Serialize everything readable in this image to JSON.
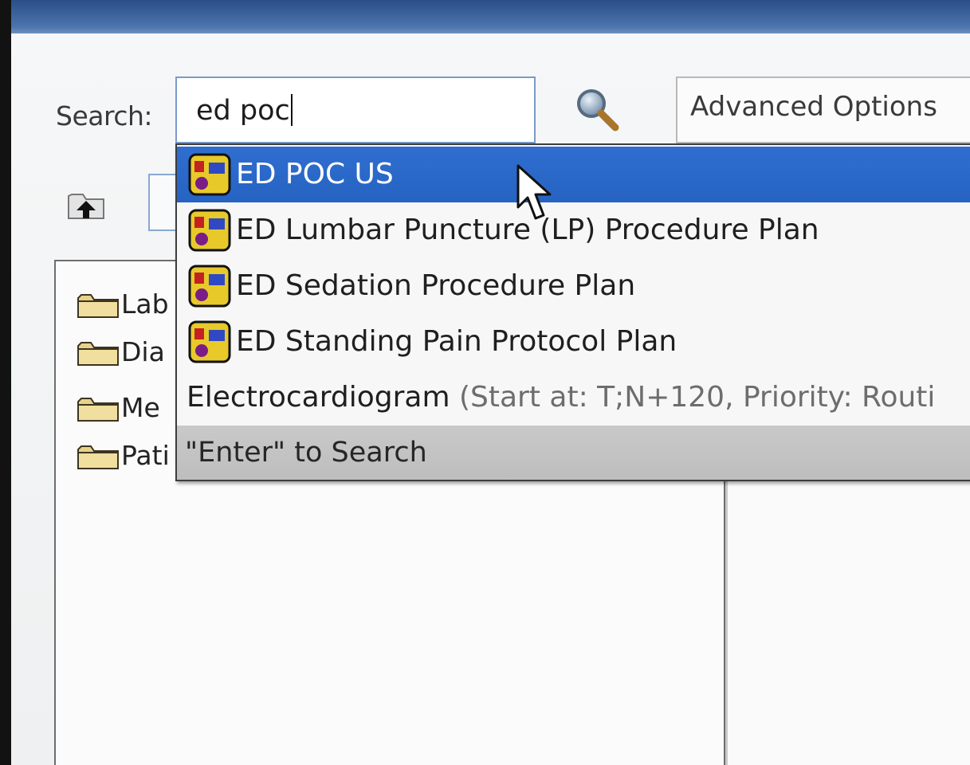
{
  "search": {
    "label": "Search:",
    "value": "ed poc"
  },
  "advanced_options": {
    "label": "Advanced Options"
  },
  "tree": {
    "items": [
      {
        "label": "Lab"
      },
      {
        "label": "Dia"
      },
      {
        "label": "Me"
      },
      {
        "label": "Pati"
      }
    ]
  },
  "dropdown": {
    "items": [
      {
        "label": "ED POC US",
        "selected": true
      },
      {
        "label": "ED Lumbar Puncture (LP) Procedure Plan"
      },
      {
        "label": "ED Sedation Procedure Plan"
      },
      {
        "label": "ED Standing Pain Protocol Plan"
      }
    ],
    "order_item": {
      "name": "Electrocardiogram",
      "details": "(Start at: T;N+120, Priority: Routi"
    },
    "footer": "\"Enter\" to Search"
  },
  "colors": {
    "selection": "#2f6ed0",
    "title_strip": "#3b62a0",
    "input_border": "#7b9ac7"
  },
  "icons": {
    "search": "magnifier-icon",
    "plan": "plan-icon",
    "folder": "folder-icon",
    "up": "up-arrow-icon",
    "cursor": "mouse-pointer-icon"
  }
}
